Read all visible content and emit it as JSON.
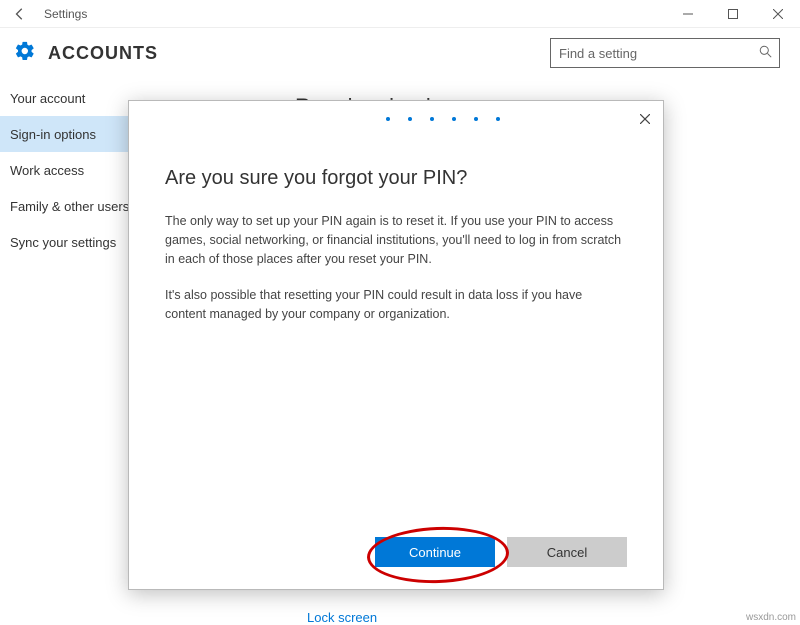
{
  "titlebar": {
    "title": "Settings"
  },
  "header": {
    "title": "ACCOUNTS",
    "search_placeholder": "Find a setting"
  },
  "sidebar": {
    "items": [
      {
        "label": "Your account"
      },
      {
        "label": "Sign-in options"
      },
      {
        "label": "Work access"
      },
      {
        "label": "Family & other users"
      },
      {
        "label": "Sync your settings"
      }
    ],
    "selected_index": 1
  },
  "main": {
    "section_title": "Require sign-in",
    "lock_link": "Lock screen"
  },
  "dialog": {
    "title": "Are you sure you forgot your PIN?",
    "paragraph1": "The only way to set up your PIN again is to reset it. If you use your PIN to access games, social networking, or financial institutions, you'll need to log in from scratch in each of those places after you reset your PIN.",
    "paragraph2": "It's also possible that resetting your PIN could result in data loss if you have content managed by your company or organization.",
    "continue_label": "Continue",
    "cancel_label": "Cancel"
  },
  "watermark": "wsxdn.com"
}
